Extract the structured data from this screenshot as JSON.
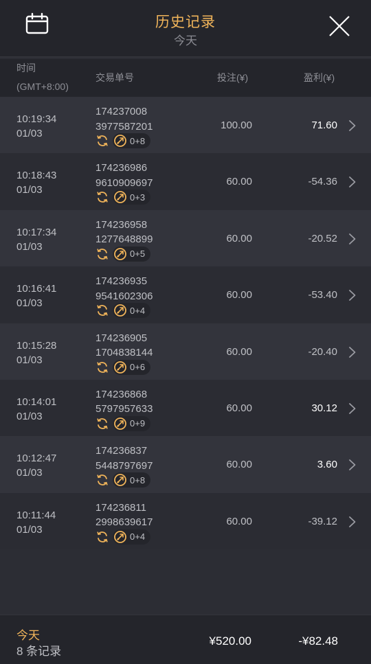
{
  "header": {
    "title": "历史记录",
    "subtitle": "今天",
    "calendar_icon": "calendar-icon",
    "close_icon": "close-icon"
  },
  "columns": {
    "time": "时间",
    "timezone": "(GMT+8:00)",
    "order": "交易单号",
    "bet": "投注(¥)",
    "profit": "盈利(¥)"
  },
  "colors": {
    "accent": "#f0b45a",
    "profit_positive": "#ffffff",
    "text": "#bfc0c5"
  },
  "rows": [
    {
      "time": "10:19:34",
      "date": "01/03",
      "order_line1": "174237008",
      "order_line2": "3977587201",
      "badge": "0+8",
      "bet": "100.00",
      "profit": "71.60"
    },
    {
      "time": "10:18:43",
      "date": "01/03",
      "order_line1": "174236986",
      "order_line2": "9610909697",
      "badge": "0+3",
      "bet": "60.00",
      "profit": "-54.36"
    },
    {
      "time": "10:17:34",
      "date": "01/03",
      "order_line1": "174236958",
      "order_line2": "1277648899",
      "badge": "0+5",
      "bet": "60.00",
      "profit": "-20.52"
    },
    {
      "time": "10:16:41",
      "date": "01/03",
      "order_line1": "174236935",
      "order_line2": "9541602306",
      "badge": "0+4",
      "bet": "60.00",
      "profit": "-53.40"
    },
    {
      "time": "10:15:28",
      "date": "01/03",
      "order_line1": "174236905",
      "order_line2": "1704838144",
      "badge": "0+6",
      "bet": "60.00",
      "profit": "-20.40"
    },
    {
      "time": "10:14:01",
      "date": "01/03",
      "order_line1": "174236868",
      "order_line2": "5797957633",
      "badge": "0+9",
      "bet": "60.00",
      "profit": "30.12"
    },
    {
      "time": "10:12:47",
      "date": "01/03",
      "order_line1": "174236837",
      "order_line2": "5448797697",
      "badge": "0+8",
      "bet": "60.00",
      "profit": "3.60"
    },
    {
      "time": "10:11:44",
      "date": "01/03",
      "order_line1": "174236811",
      "order_line2": "2998639617",
      "badge": "0+4",
      "bet": "60.00",
      "profit": "-39.12"
    }
  ],
  "footer": {
    "today": "今天",
    "count": "8 条记录",
    "total_bet": "¥520.00",
    "total_profit": "-¥82.48"
  }
}
